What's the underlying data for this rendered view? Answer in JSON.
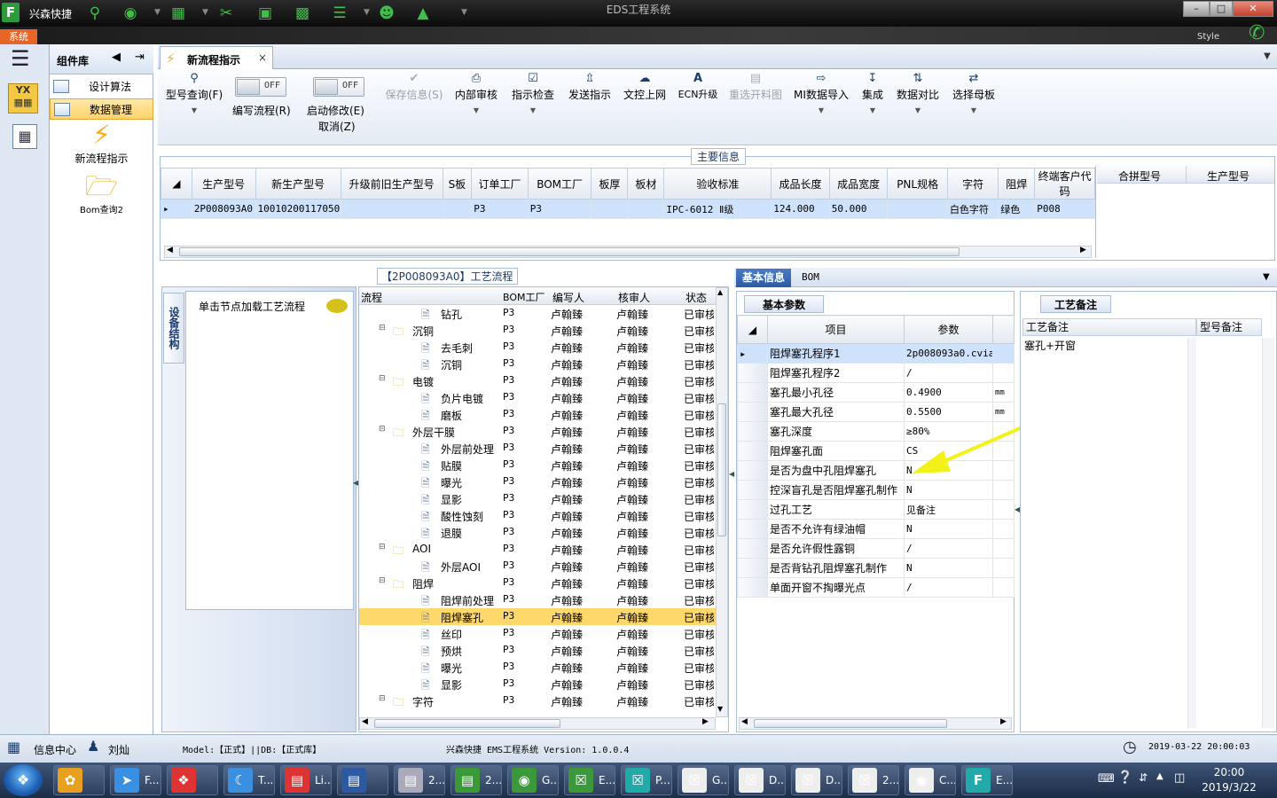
{
  "app": {
    "name": "兴森快捷",
    "window_title": "EDS工程系统",
    "system_tab": "系统",
    "style_label": "Style"
  },
  "library": {
    "title": "组件库",
    "items": [
      {
        "label": "设计算法",
        "selected": false
      },
      {
        "label": "数据管理",
        "selected": true
      }
    ],
    "big_items": [
      {
        "label": "新流程指示",
        "icon": "lightning-icon"
      },
      {
        "label": "Bom查询2",
        "icon": "folder-icon"
      }
    ]
  },
  "tab": {
    "label": "新流程指示",
    "close": "×"
  },
  "toolbar": {
    "model_query": "型号查询(F)",
    "edit_flow_toggle": "OFF",
    "edit_flow": "编写流程(R)",
    "start_modify_toggle": "OFF",
    "start_modify": "启动修改(E)",
    "cancel": "取消(Z)",
    "save_info": "保存信息(S)",
    "internal_review": "内部审核",
    "instruction_check": "指示检查",
    "send_instruction": "发送指示",
    "doc_upload": "文控上网",
    "ecn_upgrade": "ECN升级",
    "reselect": "重选开料图",
    "mi_import": "MI数据导入",
    "integrate": "集成",
    "compare": "数据对比",
    "select_board": "选择母板"
  },
  "main_info": {
    "caption": "主要信息",
    "columns": [
      "生产型号",
      "新生产型号",
      "升级前旧生产型号",
      "S板",
      "订单工厂",
      "BOM工厂",
      "板厚",
      "板材",
      "验收标准",
      "成品长度",
      "成品宽度",
      "PNL规格",
      "字符",
      "阻焊",
      "终端客户代码"
    ],
    "row": [
      "2P008093A0",
      "10010200117050",
      "",
      "",
      "P3",
      "P3",
      "",
      "",
      "IPC-6012 Ⅱ级",
      "124.000",
      "50.000",
      "",
      "白色字符",
      "绿色",
      "P008"
    ],
    "side_columns": [
      "合拼型号",
      "生产型号"
    ]
  },
  "process": {
    "caption": "【2P008093A0】工艺流程",
    "equip_tab": "设备结构",
    "load_hint": "单击节点加载工艺流程",
    "columns": [
      "流程",
      "BOM工厂",
      "编写人",
      "核审人",
      "状态"
    ],
    "rows": [
      {
        "name": "钻孔",
        "level": 2,
        "factory": "P3",
        "author": "卢翰臻",
        "reviewer": "卢翰臻",
        "status": "已审核"
      },
      {
        "name": "沉铜",
        "level": 1,
        "factory": "P3",
        "author": "卢翰臻",
        "reviewer": "卢翰臻",
        "status": "已审核"
      },
      {
        "name": "去毛刺",
        "level": 2,
        "factory": "P3",
        "author": "卢翰臻",
        "reviewer": "卢翰臻",
        "status": "已审核"
      },
      {
        "name": "沉铜",
        "level": 2,
        "factory": "P3",
        "author": "卢翰臻",
        "reviewer": "卢翰臻",
        "status": "已审核"
      },
      {
        "name": "电镀",
        "level": 1,
        "factory": "P3",
        "author": "卢翰臻",
        "reviewer": "卢翰臻",
        "status": "已审核"
      },
      {
        "name": "负片电镀",
        "level": 2,
        "factory": "P3",
        "author": "卢翰臻",
        "reviewer": "卢翰臻",
        "status": "已审核"
      },
      {
        "name": "磨板",
        "level": 2,
        "factory": "P3",
        "author": "卢翰臻",
        "reviewer": "卢翰臻",
        "status": "已审核"
      },
      {
        "name": "外层干膜",
        "level": 1,
        "factory": "P3",
        "author": "卢翰臻",
        "reviewer": "卢翰臻",
        "status": "已审核"
      },
      {
        "name": "外层前处理",
        "level": 2,
        "factory": "P3",
        "author": "卢翰臻",
        "reviewer": "卢翰臻",
        "status": "已审核"
      },
      {
        "name": "贴膜",
        "level": 2,
        "factory": "P3",
        "author": "卢翰臻",
        "reviewer": "卢翰臻",
        "status": "已审核"
      },
      {
        "name": "曝光",
        "level": 2,
        "factory": "P3",
        "author": "卢翰臻",
        "reviewer": "卢翰臻",
        "status": "已审核"
      },
      {
        "name": "显影",
        "level": 2,
        "factory": "P3",
        "author": "卢翰臻",
        "reviewer": "卢翰臻",
        "status": "已审核"
      },
      {
        "name": "酸性蚀刻",
        "level": 2,
        "factory": "P3",
        "author": "卢翰臻",
        "reviewer": "卢翰臻",
        "status": "已审核"
      },
      {
        "name": "退膜",
        "level": 2,
        "factory": "P3",
        "author": "卢翰臻",
        "reviewer": "卢翰臻",
        "status": "已审核"
      },
      {
        "name": "AOI",
        "level": 1,
        "factory": "P3",
        "author": "卢翰臻",
        "reviewer": "卢翰臻",
        "status": "已审核"
      },
      {
        "name": "外层AOI",
        "level": 2,
        "factory": "P3",
        "author": "卢翰臻",
        "reviewer": "卢翰臻",
        "status": "已审核"
      },
      {
        "name": "阻焊",
        "level": 1,
        "factory": "P3",
        "author": "卢翰臻",
        "reviewer": "卢翰臻",
        "status": "已审核"
      },
      {
        "name": "阻焊前处理",
        "level": 2,
        "factory": "P3",
        "author": "卢翰臻",
        "reviewer": "卢翰臻",
        "status": "已审核"
      },
      {
        "name": "阻焊塞孔",
        "level": 2,
        "factory": "P3",
        "author": "卢翰臻",
        "reviewer": "卢翰臻",
        "status": "已审核",
        "selected": true
      },
      {
        "name": "丝印",
        "level": 2,
        "factory": "P3",
        "author": "卢翰臻",
        "reviewer": "卢翰臻",
        "status": "已审核"
      },
      {
        "name": "预烘",
        "level": 2,
        "factory": "P3",
        "author": "卢翰臻",
        "reviewer": "卢翰臻",
        "status": "已审核"
      },
      {
        "name": "曝光",
        "level": 2,
        "factory": "P3",
        "author": "卢翰臻",
        "reviewer": "卢翰臻",
        "status": "已审核"
      },
      {
        "name": "显影",
        "level": 2,
        "factory": "P3",
        "author": "卢翰臻",
        "reviewer": "卢翰臻",
        "status": "已审核"
      },
      {
        "name": "字符",
        "level": 1,
        "factory": "P3",
        "author": "卢翰臻",
        "reviewer": "卢翰臻",
        "status": "已审核"
      }
    ]
  },
  "basic_info": {
    "tab_active": "基本信息",
    "tab_other": "BOM",
    "params_tab": "基本参数",
    "columns": [
      "项目",
      "参数"
    ],
    "rows": [
      {
        "item": "阻焊塞孔程序1",
        "value": "2p008093a0.cvia",
        "unit": "",
        "selected": true
      },
      {
        "item": "阻焊塞孔程序2",
        "value": "/",
        "unit": ""
      },
      {
        "item": "塞孔最小孔径",
        "value": "0.4900",
        "unit": "mm"
      },
      {
        "item": "塞孔最大孔径",
        "value": "0.5500",
        "unit": "mm"
      },
      {
        "item": "塞孔深度",
        "value": "≥80%",
        "unit": ""
      },
      {
        "item": "阻焊塞孔面",
        "value": "CS",
        "unit": ""
      },
      {
        "item": "是否为盘中孔阻焊塞孔",
        "value": "N",
        "unit": ""
      },
      {
        "item": "控深盲孔是否阻焊塞孔制作",
        "value": "N",
        "unit": ""
      },
      {
        "item": "过孔工艺",
        "value": "见备注",
        "unit": ""
      },
      {
        "item": "是否不允许有绿油帽",
        "value": "N",
        "unit": ""
      },
      {
        "item": "是否允许假性露铜",
        "value": "/",
        "unit": ""
      },
      {
        "item": "是否背钻孔阻焊塞孔制作",
        "value": "N",
        "unit": ""
      },
      {
        "item": "单面开窗不掏曝光点",
        "value": "/",
        "unit": ""
      }
    ]
  },
  "notes": {
    "tab": "工艺备注",
    "col1": "工艺备注",
    "col2": "型号备注",
    "text": "塞孔+开窗"
  },
  "status": {
    "info_center": "信息中心",
    "user": "刘灿",
    "model": "Model:【正式】||DB:【正式库】",
    "version": "兴森快捷  EMS工程系统  Version: 1.0.0.4",
    "datetime": "2019-03-22 20:00:03"
  },
  "taskbar": {
    "items": [
      "F...",
      "",
      "T...",
      "Li...",
      "",
      "2...",
      "2...",
      "G...",
      "E...",
      "P...",
      "G...",
      "D...",
      "D...",
      "2...",
      "C...",
      "E..."
    ],
    "time": "20:00",
    "date": "2019/3/22"
  },
  "colors": {
    "accent": "#2b5aa3",
    "selected_row": "#cfe2fb",
    "tree_selected": "#ffd86b",
    "annotation_arrow": "#f2f21a"
  }
}
